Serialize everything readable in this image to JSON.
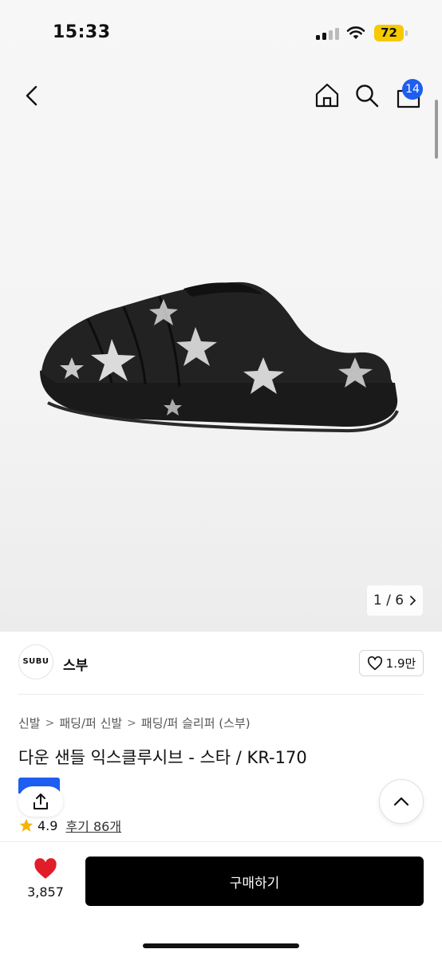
{
  "status_bar": {
    "time": "15:33",
    "battery": "72"
  },
  "nav": {
    "back_icon": "chevron-left-icon",
    "home_icon": "home-icon",
    "search_icon": "search-icon",
    "bag_icon": "shopping-bag-icon",
    "cart_count": "14"
  },
  "gallery": {
    "current": "1",
    "total": "6",
    "pager_text": "1 / 6"
  },
  "brand": {
    "logo_text": "SUBU",
    "name": "스부",
    "likes": "1.9만"
  },
  "breadcrumb": [
    "신발",
    "패딩/퍼 신발",
    "패딩/퍼 슬리퍼 (스부)"
  ],
  "product": {
    "title": "다운 샌들 익스클루시브 - 스타 / KR-170",
    "rating": "4.9",
    "reviews": "후기 86개"
  },
  "bottom": {
    "wish_count": "3,857",
    "buy_label": "구매하기"
  },
  "colors": {
    "accent_blue": "#1E5EF0",
    "battery_yellow": "#F6C900",
    "heart_red": "#E11D2A",
    "buy_black": "#000000",
    "star_yellow": "#F5B400"
  }
}
